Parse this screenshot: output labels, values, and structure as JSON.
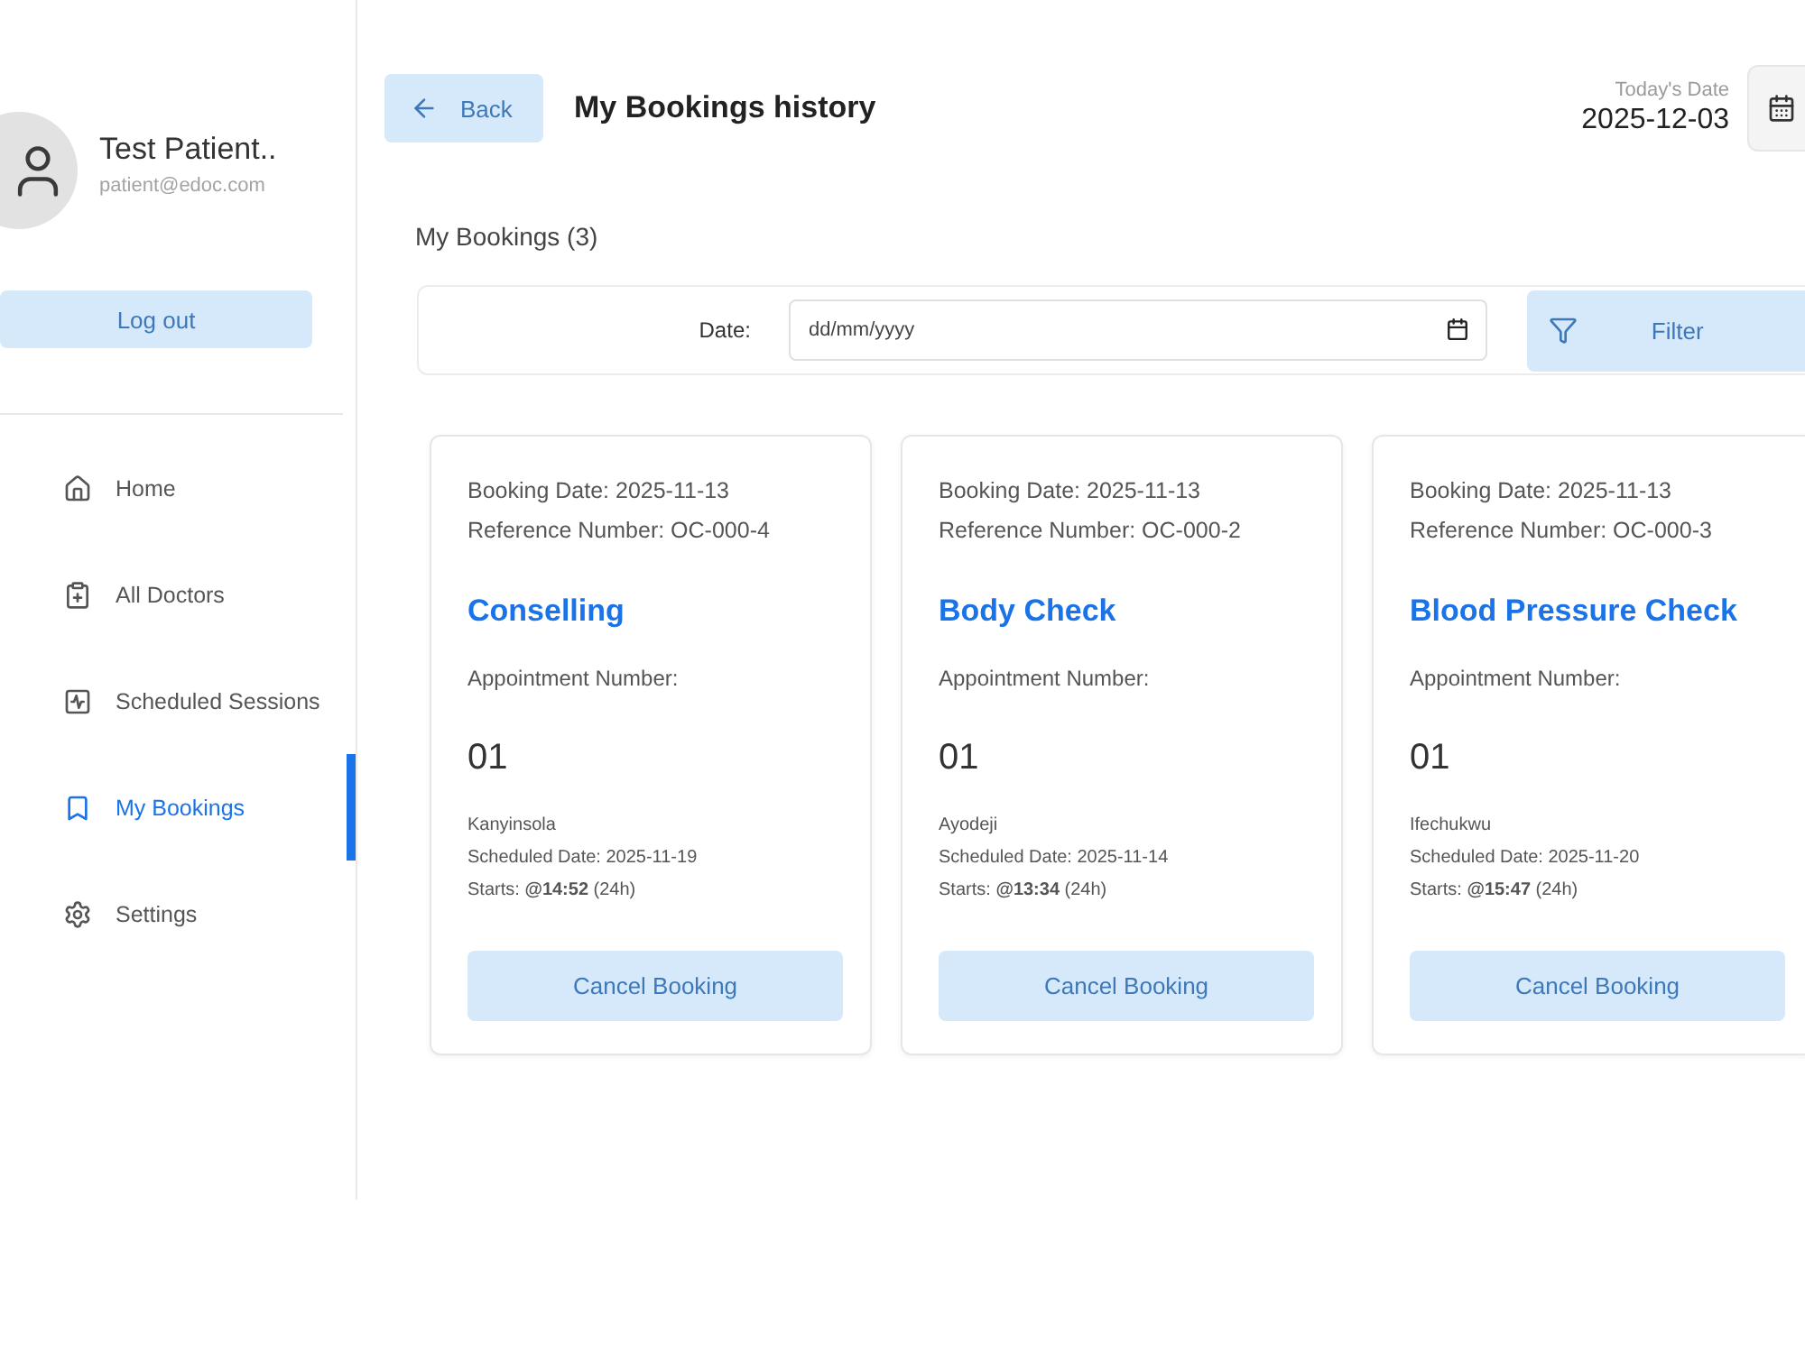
{
  "sidebar": {
    "profile": {
      "name": "Test Patient..",
      "email": "patient@edoc.com"
    },
    "logout_button": "Log out",
    "items": [
      {
        "label": "Home",
        "selected": false
      },
      {
        "label": "All Doctors",
        "selected": false
      },
      {
        "label": "Scheduled Sessions",
        "selected": false
      },
      {
        "label": "My Bookings",
        "selected": true
      },
      {
        "label": "Settings",
        "selected": false
      }
    ]
  },
  "header": {
    "back_button": "Back",
    "title": "My Bookings history",
    "today_label": "Today's Date",
    "today_date": "2025-12-03"
  },
  "bookings_heading": "My Bookings (3)",
  "filter": {
    "date_label": "Date:",
    "date_field": {
      "placeholder": "dd/mm/yyyy"
    },
    "filter_button": "Filter"
  },
  "bookings": [
    {
      "booking_date": "Booking Date: 2025-11-13",
      "reference": "Reference Number: OC-000-4",
      "title": "Conselling",
      "appointment_label": "Appointment Number:",
      "appointment_number": "01",
      "doctor": "Kanyinsola",
      "scheduled": "Scheduled Date: 2025-11-19",
      "starts": "Starts: **@14:52** (24h)",
      "cancel_button": "Cancel Booking"
    },
    {
      "booking_date": "Booking Date: 2025-11-13",
      "reference": "Reference Number: OC-000-2",
      "title": "Body Check",
      "appointment_label": "Appointment Number:",
      "appointment_number": "01",
      "doctor": "Ayodeji",
      "scheduled": "Scheduled Date: 2025-11-14",
      "starts": "Starts: **@13:34** (24h)",
      "cancel_button": "Cancel Booking"
    },
    {
      "booking_date": "Booking Date: 2025-11-13",
      "reference": "Reference Number: OC-000-3",
      "title": "Blood Pressure Check",
      "appointment_label": "Appointment Number:",
      "appointment_number": "01",
      "doctor": "Ifechukwu",
      "scheduled": "Scheduled Date: 2025-11-20",
      "starts": "Starts: **@15:47** (24h)",
      "cancel_button": "Cancel Booking"
    }
  ]
}
